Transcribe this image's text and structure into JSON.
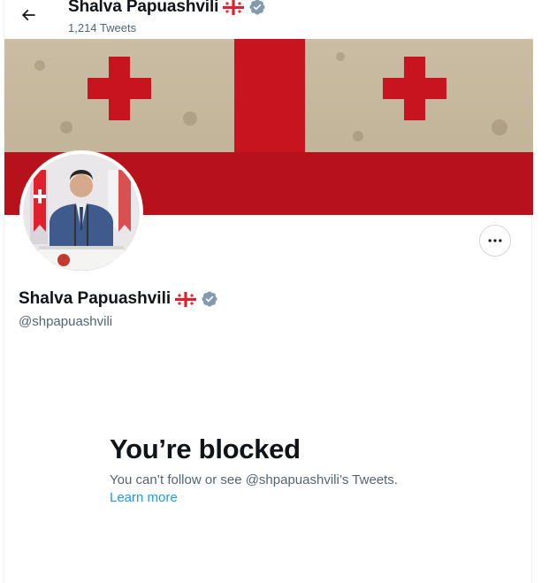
{
  "header": {
    "display_name": "Shalva Papuashvili",
    "tweet_count": "1,214 Tweets",
    "back_icon": "arrow-left-icon"
  },
  "profile": {
    "display_name": "Shalva Papuashvili",
    "handle": "@shpapuashvili",
    "flag_icon": "georgia-flag-icon",
    "verified_icon": "verified-badge-icon"
  },
  "actions": {
    "more_icon": "more-horizontal-icon"
  },
  "blocked": {
    "title": "You’re blocked",
    "message": "You can’t follow or see @shpapuashvili’s Tweets.",
    "learn_more": "Learn more"
  },
  "colors": {
    "flag_red": "#cc1f28",
    "link": "#1d9bf0",
    "secondary_text": "#536471",
    "verified_gray": "#829aab"
  }
}
